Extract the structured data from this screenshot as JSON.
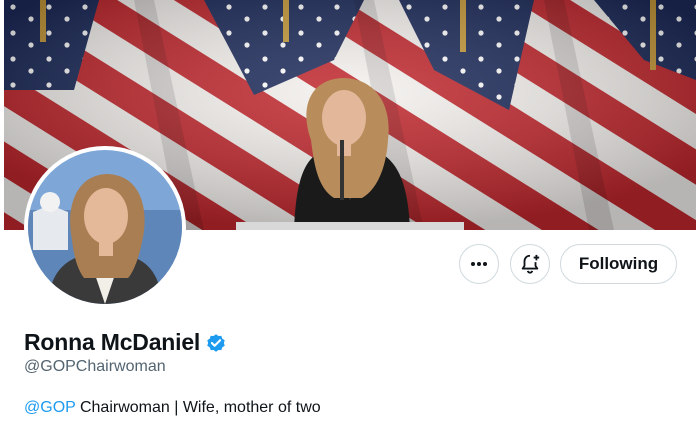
{
  "profile": {
    "display_name": "Ronna McDaniel",
    "handle": "@GOPChairwoman",
    "verified": true,
    "bio_mention": "@GOP",
    "bio_text": " Chairwoman | Wife, mother of two"
  },
  "actions": {
    "more_icon": "more-icon",
    "notify_icon": "bell-plus-icon",
    "follow_label": "Following"
  },
  "colors": {
    "accent": "#1d9bf0",
    "text": "#0f1419",
    "muted": "#536471",
    "border": "#cfd9de"
  }
}
